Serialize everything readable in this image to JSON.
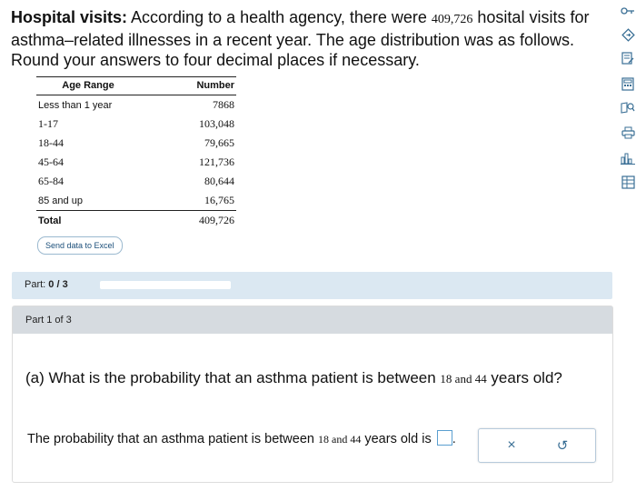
{
  "problem": {
    "title": "Hospital visits:",
    "text_a": " According to a health agency, there were ",
    "total": "409,726",
    "text_b": " hosital visits for asthma–related illnesses in a recent year. The age distribution was as follows. Round your answers to four decimal places if necessary."
  },
  "table": {
    "headers": [
      "Age Range",
      "Number"
    ],
    "rows": [
      {
        "age": "Less than 1 year",
        "number": "7868"
      },
      {
        "age": "1-17",
        "number": "103,048"
      },
      {
        "age": "18-44",
        "number": "79,665"
      },
      {
        "age": "45-64",
        "number": "121,736"
      },
      {
        "age": "65-84",
        "number": "80,644"
      },
      {
        "age": "85 and up",
        "number": "16,765"
      }
    ],
    "total": {
      "age": "Total",
      "number": "409,726"
    }
  },
  "excel_button": "Send data to Excel",
  "part_progress": {
    "label": "Part:",
    "value": "0 / 3",
    "fraction": 0.0
  },
  "part_header": "Part 1 of 3",
  "question": {
    "prefix": "(a) What is the probability that an asthma patient is between ",
    "range": "18 and 44",
    "suffix": " years old?"
  },
  "answer": {
    "prefix": "The probability that an asthma patient is between ",
    "range": "18 and 44",
    "mid": " years old is ",
    "end": "."
  },
  "actions": {
    "clear": "×",
    "undo": "↺"
  },
  "colors": {
    "accent": "#2a7ab0",
    "part_bar": "#dbe8f2",
    "part_header": "#d6dbe0"
  },
  "tools": [
    "key-icon",
    "diamond-arrow-icon",
    "notes-icon",
    "calculator-icon",
    "search-book-icon",
    "printer-icon",
    "bar-chart-icon",
    "data-table-icon"
  ]
}
